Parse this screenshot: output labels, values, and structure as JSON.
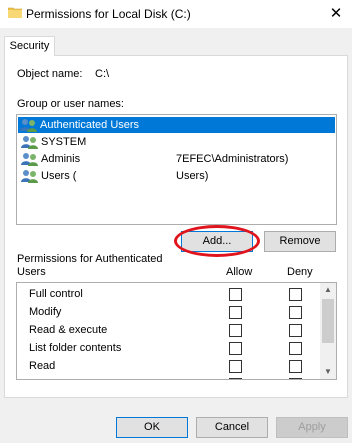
{
  "window": {
    "title": "Permissions for Local Disk (C:)",
    "close_glyph": "✕"
  },
  "tabs": [
    {
      "label": "Security"
    }
  ],
  "object": {
    "label": "Object name:",
    "value": "C:\\"
  },
  "groups": {
    "label": "Group or user names:",
    "items": [
      {
        "name": "Authenticated Users",
        "extra": "",
        "selected": true
      },
      {
        "name": "SYSTEM",
        "extra": "",
        "selected": false
      },
      {
        "name": "Adminis",
        "extra": "7EFEC\\Administrators)",
        "selected": false
      },
      {
        "name": "Users (",
        "extra": "Users)",
        "selected": false
      }
    ]
  },
  "buttons": {
    "add": "Add...",
    "remove": "Remove",
    "ok": "OK",
    "cancel": "Cancel",
    "apply": "Apply"
  },
  "permissions": {
    "label_line1": "Permissions for Authenticated",
    "label_line2": "Users",
    "allow_header": "Allow",
    "deny_header": "Deny",
    "rows": [
      {
        "name": "Full control",
        "allow": false,
        "deny": false
      },
      {
        "name": "Modify",
        "allow": false,
        "deny": false
      },
      {
        "name": "Read & execute",
        "allow": false,
        "deny": false
      },
      {
        "name": "List folder contents",
        "allow": false,
        "deny": false
      },
      {
        "name": "Read",
        "allow": false,
        "deny": false
      }
    ]
  },
  "colors": {
    "selection": "#0078d7",
    "highlight_ellipse": "#e0141d",
    "folder": "#f0c24b"
  },
  "icons": {
    "title": "folder-icon",
    "user": "users-group-icon"
  }
}
